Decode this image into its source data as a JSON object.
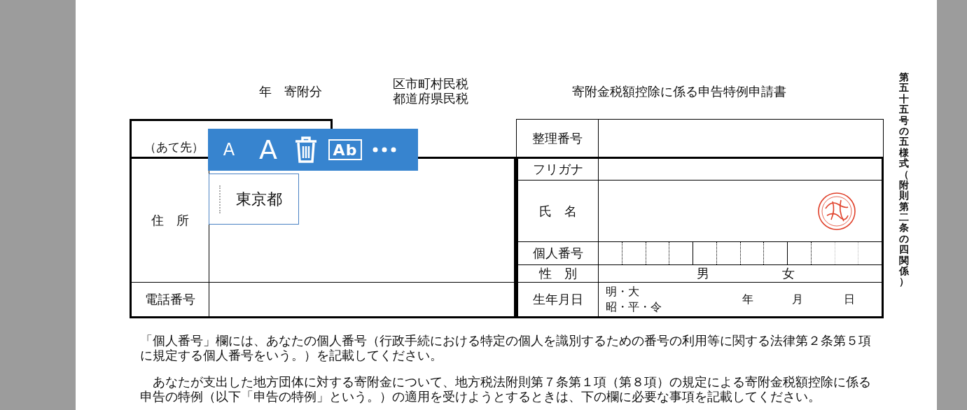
{
  "header": {
    "year_label": "年　寄附分",
    "tax_lines": [
      "区市町村民税",
      "都道府県民税"
    ],
    "title": "寄附金税額控除に係る申告特例申請書"
  },
  "side_note": "第五十五号の五様式（附則第二条の四関係）",
  "left_table": {
    "addressee": "（あて先）",
    "address_label": "住　所",
    "phone_label": "電話番号"
  },
  "right_table": {
    "rows": [
      {
        "kind": "blank",
        "label": "整理番号"
      },
      {
        "kind": "blank",
        "label": "フリガナ"
      },
      {
        "kind": "name",
        "label": "氏　名"
      },
      {
        "kind": "digits",
        "label": "個人番号"
      },
      {
        "kind": "gender",
        "label": "性　別",
        "options": [
          "男",
          "女"
        ]
      },
      {
        "kind": "birth",
        "label": "生年月日",
        "eras": [
          "明・大",
          "昭・平・令"
        ],
        "date_labels": [
          "年",
          "月",
          "日"
        ]
      }
    ]
  },
  "text_box": {
    "value": "東京都"
  },
  "toolbar": {
    "buttons": [
      {
        "kind": "font-smaller",
        "label": "A"
      },
      {
        "kind": "font-larger",
        "label": "A"
      },
      {
        "kind": "delete"
      },
      {
        "kind": "style",
        "label": "Ab"
      },
      {
        "kind": "more"
      }
    ]
  },
  "notes": [
    "「個人番号」欄には、あなたの個人番号（行政手続における特定の個人を識別するための番号の利用等に関する法律第２条第５項に規定する個人番号をいう。）を記載してください。",
    "　あなたが支出した地方団体に対する寄附金について、地方税法附則第７条第１項（第８項）の規定による寄附金税額控除に係る申告の特例（以下「申告の特例」という。）の適用を受けようとするときは、下の欄に必要な事項を記載してください。"
  ]
}
